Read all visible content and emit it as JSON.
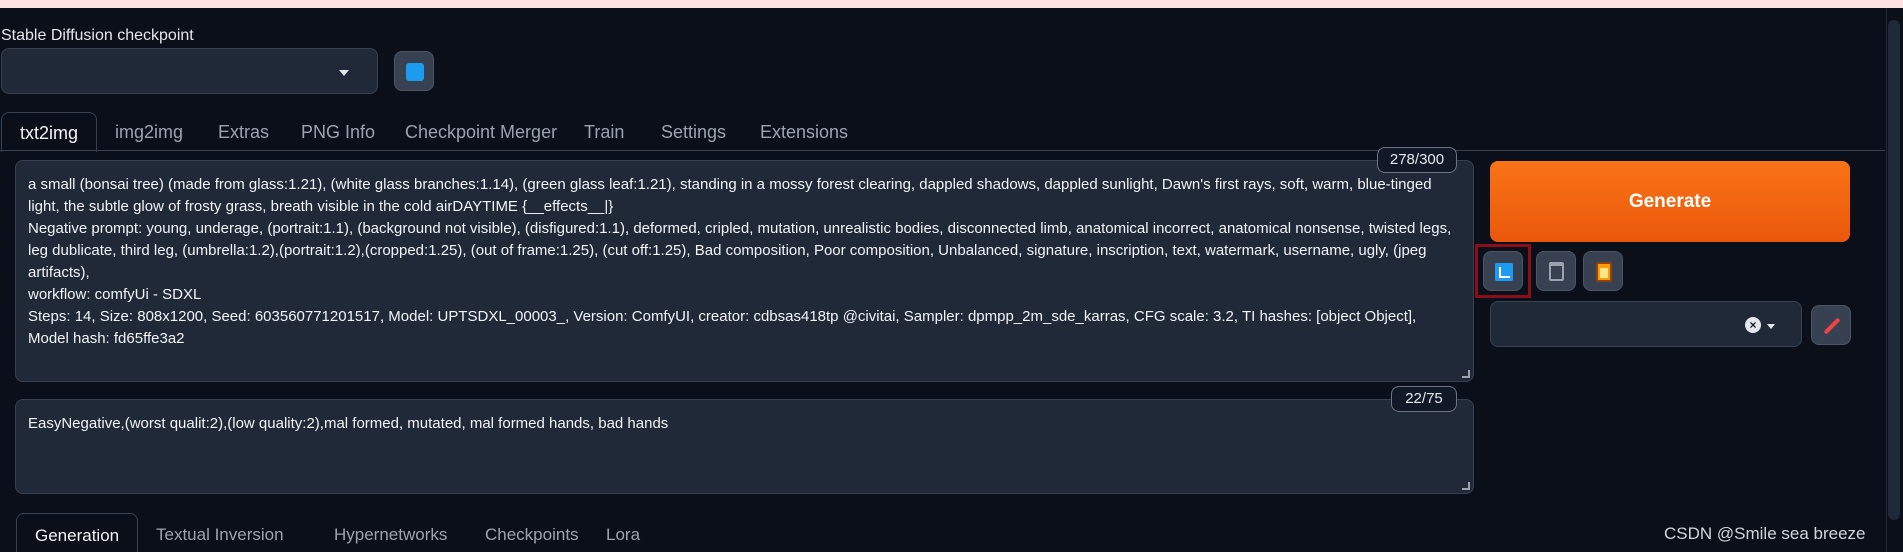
{
  "checkpoint": {
    "label": "Stable Diffusion checkpoint",
    "value": ""
  },
  "tabs": [
    "txt2img",
    "img2img",
    "Extras",
    "PNG Info",
    "Checkpoint Merger",
    "Train",
    "Settings",
    "Extensions"
  ],
  "prompt": {
    "counter": "278/300",
    "lines": [
      "a small (bonsai tree) (made from glass:1.21), (white glass branches:1.14), (green glass leaf:1.21), standing in a mossy forest clearing,  dappled shadows, dappled sunlight, Dawn's first rays, soft, warm, blue-tinged light, the subtle glow of frosty grass, breath visible in the cold airDAYTIME {__effects__|}",
      "Negative prompt: young, underage, (portrait:1.1), (background not visible), (disfigured:1.1), deformed, cripled, mutation, unrealistic bodies,  disconnected limb, anatomical incorrect, anatomical nonsense, twisted legs, leg dublicate, third leg, (umbrella:1.2),(portrait:1.2),(cropped:1.25), (out of frame:1.25), (cut off:1.25), Bad composition, Poor composition, Unbalanced, signature, inscription, text, watermark, username, ugly, (jpeg artifacts),",
      "workflow: comfyUi - SDXL",
      "Steps: 14, Size: 808x1200, Seed: 603560771201517, Model: UPTSDXL_00003_, Version: ComfyUI, creator: cdbsas418tp  @civitai, Sampler: dpmpp_2m_sde_karras, CFG scale: 3.2, TI hashes: [object Object], Model hash: fd65ffe3a2"
    ]
  },
  "negative_prompt": {
    "counter": "22/75",
    "text": "EasyNegative,(worst qualit:2),(low quality:2),mal formed, mutated, mal formed hands, bad hands"
  },
  "generate_label": "Generate",
  "tools": {
    "read_params_icon": "arrow-down-left-icon",
    "clear_icon": "trash-icon",
    "paste_icon": "clipboard-icon"
  },
  "styles": {
    "value": "",
    "clear_icon": "×"
  },
  "subtabs": [
    "Generation",
    "Textual Inversion",
    "Hypernetworks",
    "Checkpoints",
    "Lora"
  ],
  "watermark": "CSDN @Smile sea breeze",
  "colors": {
    "generate": "#ea580c",
    "accent": "#1d9bf0",
    "highlight_border": "#8b0f1a"
  }
}
